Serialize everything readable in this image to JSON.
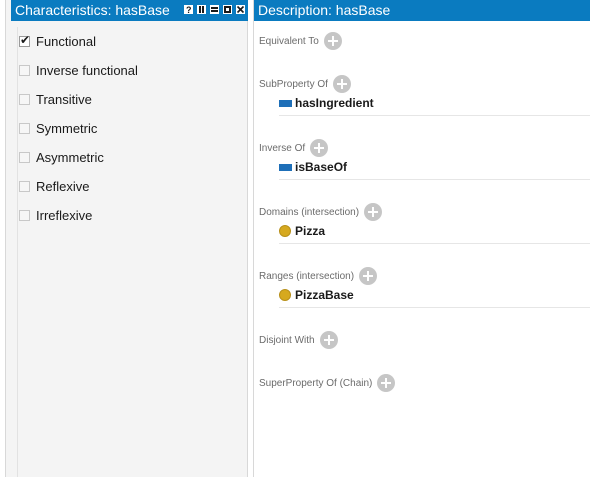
{
  "characteristics": {
    "title": "Characteristics: hasBase",
    "items": [
      {
        "label": "Functional",
        "checked": true
      },
      {
        "label": "Inverse functional",
        "checked": false
      },
      {
        "label": "Transitive",
        "checked": false
      },
      {
        "label": "Symmetric",
        "checked": false
      },
      {
        "label": "Asymmetric",
        "checked": false
      },
      {
        "label": "Reflexive",
        "checked": false
      },
      {
        "label": "Irreflexive",
        "checked": false
      }
    ],
    "check_mark": "✔",
    "help_glyph": "?"
  },
  "description": {
    "title": "Description: hasBase",
    "sections": {
      "equivalent_to": {
        "label": "Equivalent To"
      },
      "subproperty_of": {
        "label": "SubProperty Of",
        "entry": "hasIngredient"
      },
      "inverse_of": {
        "label": "Inverse Of",
        "entry": "isBaseOf"
      },
      "domains": {
        "label": "Domains (intersection)",
        "entry": "Pizza"
      },
      "ranges": {
        "label": "Ranges (intersection)",
        "entry": "PizzaBase"
      },
      "disjoint_with": {
        "label": "Disjoint With"
      },
      "superproperty_of_chain": {
        "label": "SuperProperty Of (Chain)"
      }
    }
  },
  "colors": {
    "header": "#0a7bc0",
    "property_icon": "#1e6fb8",
    "class_icon": "#d6a91f",
    "add_button": "#c6c6c6"
  },
  "icons": {
    "header_buttons": [
      "help-icon",
      "split-icon",
      "minimize-icon",
      "maximize-icon",
      "close-icon"
    ],
    "add": "add-circle-icon",
    "property": "object-property-icon",
    "class": "class-icon"
  }
}
